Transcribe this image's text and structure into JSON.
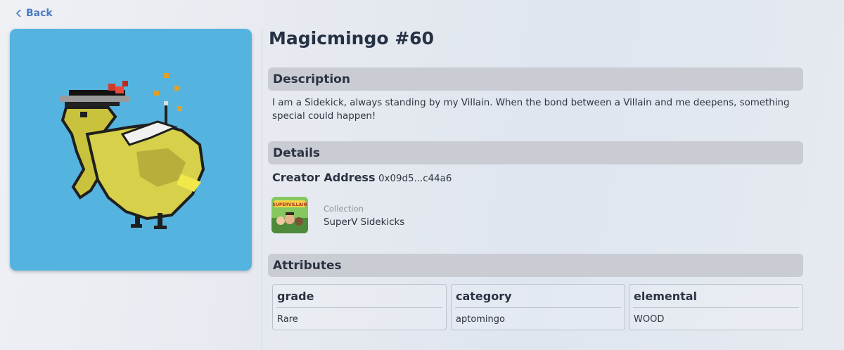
{
  "nav": {
    "back_label": "Back"
  },
  "nft": {
    "title": "Magicmingo #60",
    "image_background": "#55b3df"
  },
  "description": {
    "heading": "Description",
    "text": "I am a Sidekick, always standing by my Villain. When the bond between a Villain and me deepens, something special could happen!"
  },
  "details": {
    "heading": "Details",
    "creator_label": "Creator Address",
    "creator_value": "0x09d5...c44a6",
    "collection_label": "Collection",
    "collection_value": "SuperV Sidekicks",
    "collection_logo_text": "SUPERVILLAIN"
  },
  "attributes": {
    "heading": "Attributes",
    "items": [
      {
        "name": "grade",
        "value": "Rare"
      },
      {
        "name": "category",
        "value": "aptomingo"
      },
      {
        "name": "elemental",
        "value": "WOOD"
      }
    ]
  },
  "colors": {
    "accent": "#4c7cc2",
    "section_header": "#c9ccd3"
  }
}
